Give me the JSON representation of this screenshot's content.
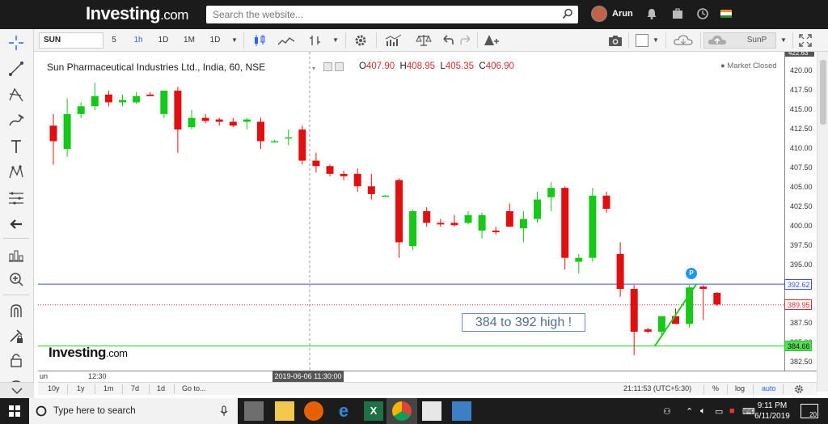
{
  "header": {
    "logo_main": "Investing",
    "logo_suffix": ".com",
    "search_placeholder": "Search the website...",
    "user_name": "Arun"
  },
  "toolbar": {
    "symbol": "SUN",
    "timeframes": [
      "5",
      "1h",
      "1D",
      "1M",
      "1D"
    ],
    "active_timeframe": "1h",
    "symbol_right": "SunP"
  },
  "legend": {
    "title": "Sun Pharmaceutical Industries Ltd., India, 60, NSE",
    "open_label": "O",
    "open": "407.90",
    "high_label": "H",
    "high": "408.95",
    "low_label": "L",
    "low": "405.35",
    "close_label": "C",
    "close": "406.90",
    "status": "Market Closed"
  },
  "chart_data": {
    "type": "candlestick",
    "title": "Sun Pharmaceutical Industries Ltd., India, 60, NSE",
    "ylim": [
      381.5,
      422.5
    ],
    "y_ticks": [
      "420.00",
      "417.50",
      "415.00",
      "412.50",
      "410.00",
      "407.50",
      "405.00",
      "402.50",
      "400.00",
      "397.50",
      "395.00",
      "392.50",
      "387.50",
      "385.00",
      "382.50"
    ],
    "x_tick_labels": [
      "un",
      "12:30"
    ],
    "crosshair_x_label": "2019-06-06 11:30:00",
    "top_cut_label": "422.63",
    "price_lines": [
      {
        "label": "392.62",
        "value": 392.62,
        "color": "#3c4fe0",
        "style": "solid"
      },
      {
        "label": "389.95",
        "value": 389.95,
        "color": "#d32f2f",
        "style": "dotted"
      },
      {
        "label": "384.66",
        "value": 384.66,
        "color": "#22cc22",
        "style": "solid"
      }
    ],
    "candles": [
      {
        "o": 413.0,
        "h": 414.5,
        "l": 408.0,
        "c": 411.0
      },
      {
        "o": 410.0,
        "h": 416.5,
        "l": 409.0,
        "c": 414.5
      },
      {
        "o": 414.5,
        "h": 416.0,
        "l": 414.0,
        "c": 415.5
      },
      {
        "o": 415.5,
        "h": 418.5,
        "l": 415.0,
        "c": 416.8
      },
      {
        "o": 417.0,
        "h": 417.5,
        "l": 415.5,
        "c": 416.0
      },
      {
        "o": 416.0,
        "h": 417.0,
        "l": 415.5,
        "c": 416.3
      },
      {
        "o": 416.0,
        "h": 417.3,
        "l": 415.8,
        "c": 416.8
      },
      {
        "o": 417.0,
        "h": 417.3,
        "l": 416.8,
        "c": 416.8
      },
      {
        "o": 414.5,
        "h": 417.5,
        "l": 414.0,
        "c": 417.5
      },
      {
        "o": 417.5,
        "h": 418.0,
        "l": 409.5,
        "c": 412.5
      },
      {
        "o": 412.8,
        "h": 415.0,
        "l": 412.5,
        "c": 414.0
      },
      {
        "o": 414.0,
        "h": 414.5,
        "l": 413.3,
        "c": 413.6
      },
      {
        "o": 413.8,
        "h": 414.0,
        "l": 413.0,
        "c": 413.5
      },
      {
        "o": 413.5,
        "h": 414.0,
        "l": 412.8,
        "c": 413.0
      },
      {
        "o": 413.5,
        "h": 414.0,
        "l": 412.5,
        "c": 413.8
      },
      {
        "o": 413.5,
        "h": 414.0,
        "l": 410.0,
        "c": 411.0
      },
      {
        "o": 411.0,
        "h": 411.2,
        "l": 410.8,
        "c": 411.0
      },
      {
        "o": 411.5,
        "h": 412.5,
        "l": 410.5,
        "c": 411.5
      },
      {
        "o": 412.5,
        "h": 413.0,
        "l": 408.0,
        "c": 408.5
      },
      {
        "o": 408.5,
        "h": 409.5,
        "l": 407.0,
        "c": 407.8
      },
      {
        "o": 407.8,
        "h": 408.0,
        "l": 406.5,
        "c": 406.8
      },
      {
        "o": 406.8,
        "h": 407.2,
        "l": 406.0,
        "c": 406.5
      },
      {
        "o": 406.8,
        "h": 407.5,
        "l": 404.5,
        "c": 405.2
      },
      {
        "o": 405.2,
        "h": 406.8,
        "l": 403.5,
        "c": 404.2
      },
      {
        "o": 404.0,
        "h": 404.1,
        "l": 403.9,
        "c": 404.0
      },
      {
        "o": 406.0,
        "h": 406.2,
        "l": 396.0,
        "c": 398.0
      },
      {
        "o": 397.5,
        "h": 402.2,
        "l": 397.0,
        "c": 402.0
      },
      {
        "o": 402.0,
        "h": 402.5,
        "l": 400.0,
        "c": 400.5
      },
      {
        "o": 400.5,
        "h": 401.0,
        "l": 400.0,
        "c": 400.3
      },
      {
        "o": 400.5,
        "h": 401.5,
        "l": 400.0,
        "c": 400.2
      },
      {
        "o": 400.5,
        "h": 402.0,
        "l": 400.3,
        "c": 401.5
      },
      {
        "o": 399.5,
        "h": 401.8,
        "l": 398.5,
        "c": 401.5
      },
      {
        "o": 399.5,
        "h": 400.0,
        "l": 399.0,
        "c": 399.3
      },
      {
        "o": 402.0,
        "h": 403.0,
        "l": 400.0,
        "c": 400.0
      },
      {
        "o": 399.8,
        "h": 402.0,
        "l": 398.0,
        "c": 401.0
      },
      {
        "o": 401.0,
        "h": 404.5,
        "l": 400.5,
        "c": 403.5
      },
      {
        "o": 403.8,
        "h": 405.7,
        "l": 402.0,
        "c": 405.0
      },
      {
        "o": 405.0,
        "h": 405.2,
        "l": 394.5,
        "c": 396.0
      },
      {
        "o": 395.5,
        "h": 396.5,
        "l": 394.0,
        "c": 396.0
      },
      {
        "o": 396.0,
        "h": 405.0,
        "l": 395.5,
        "c": 404.0
      },
      {
        "o": 404.0,
        "h": 404.5,
        "l": 401.8,
        "c": 402.3
      },
      {
        "o": 396.5,
        "h": 398.0,
        "l": 391.0,
        "c": 392.0
      },
      {
        "o": 392.0,
        "h": 392.5,
        "l": 383.5,
        "c": 386.5
      },
      {
        "o": 386.8,
        "h": 387.0,
        "l": 386.3,
        "c": 386.5
      },
      {
        "o": 386.5,
        "h": 388.5,
        "l": 386.0,
        "c": 388.5
      },
      {
        "o": 388.5,
        "h": 389.5,
        "l": 387.5,
        "c": 387.5
      },
      {
        "o": 387.5,
        "h": 392.5,
        "l": 387.0,
        "c": 392.2
      },
      {
        "o": 392.3,
        "h": 392.5,
        "l": 388.0,
        "c": 392.0
      },
      {
        "o": 391.5,
        "h": 391.6,
        "l": 389.8,
        "c": 390.0
      }
    ],
    "trend_line": {
      "from": {
        "candle": 43.5,
        "y": 384.66
      },
      "to": {
        "candle": 46.5,
        "y": 392.62
      },
      "color": "#22cc22"
    },
    "annotation": "384 to 392 high !",
    "watermark": "Investing.com",
    "marker_label": "P"
  },
  "range_bar": {
    "items": [
      "10y",
      "1y",
      "1m",
      "7d",
      "1d",
      "Go to..."
    ],
    "time": "21:11:53 (UTC+5:30)",
    "percent": "%",
    "log": "log",
    "auto": "auto"
  },
  "taskbar": {
    "search_text": "Type here to search",
    "time": "9:11 PM",
    "date": "6/11/2019",
    "notif_count": "20"
  },
  "colors": {
    "up": "#18c818",
    "down": "#e01010",
    "accent": "#2962ff"
  }
}
